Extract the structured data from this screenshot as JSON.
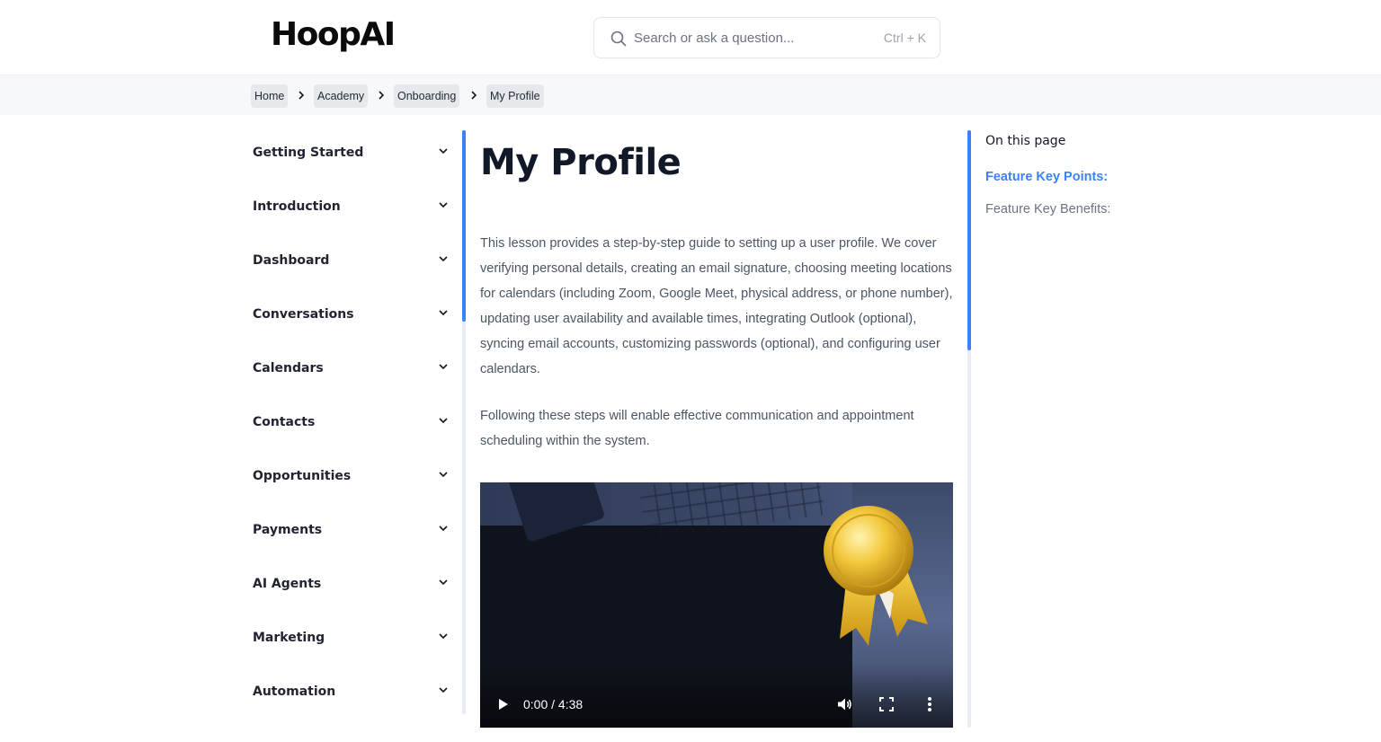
{
  "header": {
    "logo": "HoopAI",
    "search": {
      "placeholder": "Search or ask a question...",
      "shortcut": "Ctrl + K"
    }
  },
  "breadcrumb": [
    "Home",
    "Academy",
    "Onboarding",
    "My Profile"
  ],
  "sidebar": {
    "items": [
      {
        "label": "Getting Started"
      },
      {
        "label": "Introduction"
      },
      {
        "label": "Dashboard"
      },
      {
        "label": "Conversations"
      },
      {
        "label": "Calendars"
      },
      {
        "label": "Contacts"
      },
      {
        "label": "Opportunities"
      },
      {
        "label": "Payments"
      },
      {
        "label": "AI Agents"
      },
      {
        "label": "Marketing"
      },
      {
        "label": "Automation"
      }
    ]
  },
  "main": {
    "title": "My Profile",
    "paragraphs": [
      "This lesson provides a step-by-step guide to setting up a user profile. We cover verifying personal details, creating an email signature, choosing meeting locations for calendars (including Zoom, Google Meet, physical address, or phone number), updating user availability and available times, integrating Outlook (optional), syncing email accounts, customizing passwords (optional), and configuring user calendars.",
      "Following these steps will enable effective communication and appointment scheduling within the system."
    ],
    "video": {
      "time": "0:00 / 4:38",
      "progress": 0
    }
  },
  "toc": {
    "title": "On this page",
    "links": [
      {
        "label": "Feature Key Points:",
        "active": true
      },
      {
        "label": "Feature Key Benefits:",
        "active": false
      }
    ]
  },
  "colors": {
    "accent": "#3b82f6",
    "breadcrumb_bg": "#f7f8fa",
    "crumb_chip": "#e6e8eb"
  }
}
